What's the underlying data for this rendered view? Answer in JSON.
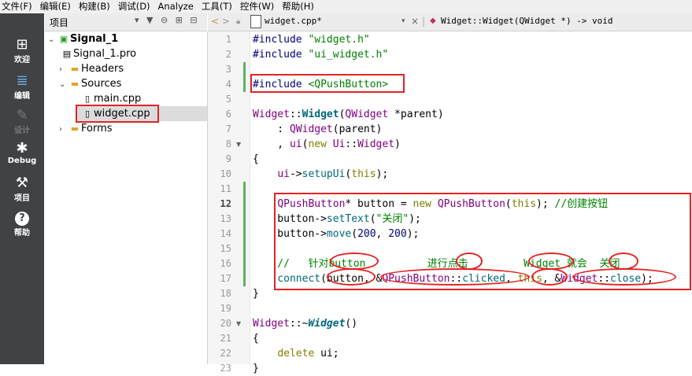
{
  "menubar": [
    "文件(F)",
    "编辑(E)",
    "构建(B)",
    "调试(D)",
    "Analyze",
    "工具(T)",
    "控件(W)",
    "帮助(H)"
  ],
  "project_panel": {
    "title": "项目",
    "tools": "▾ ▼ ⊖ ⊞ ⊟"
  },
  "editor_bar": {
    "file_name": "widget.cpp*",
    "close_glyph": "×",
    "function_path": "Widget::Widget(QWidget *) -> void"
  },
  "modes": [
    {
      "icon": "grid-icon",
      "glyph": "⊞",
      "label": "欢迎",
      "enabled": true
    },
    {
      "icon": "edit-icon",
      "glyph": "≣",
      "label": "编辑",
      "enabled": true
    },
    {
      "icon": "design-icon",
      "glyph": "✎",
      "label": "设计",
      "enabled": false
    },
    {
      "icon": "debug-icon",
      "glyph": "✱",
      "label": "Debug",
      "enabled": true
    },
    {
      "icon": "wrench-icon",
      "glyph": "⚒",
      "label": "项目",
      "enabled": true
    },
    {
      "icon": "help-icon",
      "glyph": "?",
      "label": "帮助",
      "enabled": true
    }
  ],
  "tree": [
    {
      "label": "Signal_1",
      "level": 0,
      "expanded": true
    },
    {
      "label": "Signal_1.pro",
      "level": 1
    },
    {
      "label": "Headers",
      "level": 1,
      "expanded": false
    },
    {
      "label": "Sources",
      "level": 1,
      "expanded": true
    },
    {
      "label": "main.cpp",
      "level": 2
    },
    {
      "label": "widget.cpp",
      "level": 2,
      "selected": true
    },
    {
      "label": "Forms",
      "level": 1,
      "expanded": false
    }
  ],
  "line_numbers": [
    "1",
    "2",
    "3",
    "4",
    "5",
    "6",
    "7",
    "8",
    "9",
    "10",
    "11",
    "12",
    "13",
    "14",
    "15",
    "16",
    "17",
    "18",
    "19",
    "20",
    "21",
    "22",
    "23"
  ],
  "current_line": "12",
  "code": {
    "l1": {
      "pp": "#include",
      "str": " \"widget.h\""
    },
    "l2": {
      "pp": "#include",
      "str": " \"ui_widget.h\""
    },
    "l4": {
      "pp": "#include",
      "str": " <QPushButton>"
    },
    "l6": {
      "cls": "Widget",
      "sep": "::",
      "fn": "Widget",
      "p1": "(",
      "cls2": "QWidget",
      "rest": " *parent)"
    },
    "l7": {
      "pre": "    : ",
      "cls": "QWidget",
      "rest": "(parent)"
    },
    "l8": {
      "pre": "    , ",
      "v": "ui",
      "p": "(",
      "kw": "new",
      "sp": " ",
      "cls": "Ui",
      "sep": "::",
      "cls2": "Widget",
      "end": ")"
    },
    "l9": "{",
    "l10": {
      "pre": "    ",
      "v": "ui",
      "arrow": "->",
      "fn": "setupUi",
      "p": "(",
      "kw": "this",
      "end": ");"
    },
    "l12": {
      "pre": "    ",
      "cls": "QPushButton",
      "t1": "* button = ",
      "kw": "new",
      "sp": " ",
      "cls2": "QPushButton",
      "p": "(",
      "kw2": "this",
      "t2": "); ",
      "cmt": "//创建按钮"
    },
    "l13": {
      "pre": "    button->",
      "fn": "setText",
      "p": "(",
      "str": "\"关闭\"",
      "end": ");"
    },
    "l14": {
      "pre": "    button->",
      "fn": "move",
      "p": "(",
      "n1": "200",
      "c": ", ",
      "n2": "200",
      "end": ");"
    },
    "l16": "    //   针对button          进行点击         Widget 就会  关闭",
    "l17": {
      "pre": "    ",
      "fn": "connect",
      "t1": "(button, &",
      "cls": "QPushButton",
      "sep": "::",
      "fn2": "clicked",
      "t2": ", ",
      "kw": "this",
      "t3": ", &",
      "cls2": "Widget",
      "sep2": "::",
      "fn3": "close",
      "end": ");"
    },
    "l18": "}",
    "l20": {
      "cls": "Widget",
      "sep": "::~",
      "fn": "Widget",
      "end": "()"
    },
    "l21": "{",
    "l22": {
      "pre": "    ",
      "kw": "delete",
      "end": " ui;"
    },
    "l23": "}"
  },
  "accent_colors": {
    "annotation": "#e52222",
    "mode_bar": "#404244",
    "change_marker": "#5fb35f"
  }
}
